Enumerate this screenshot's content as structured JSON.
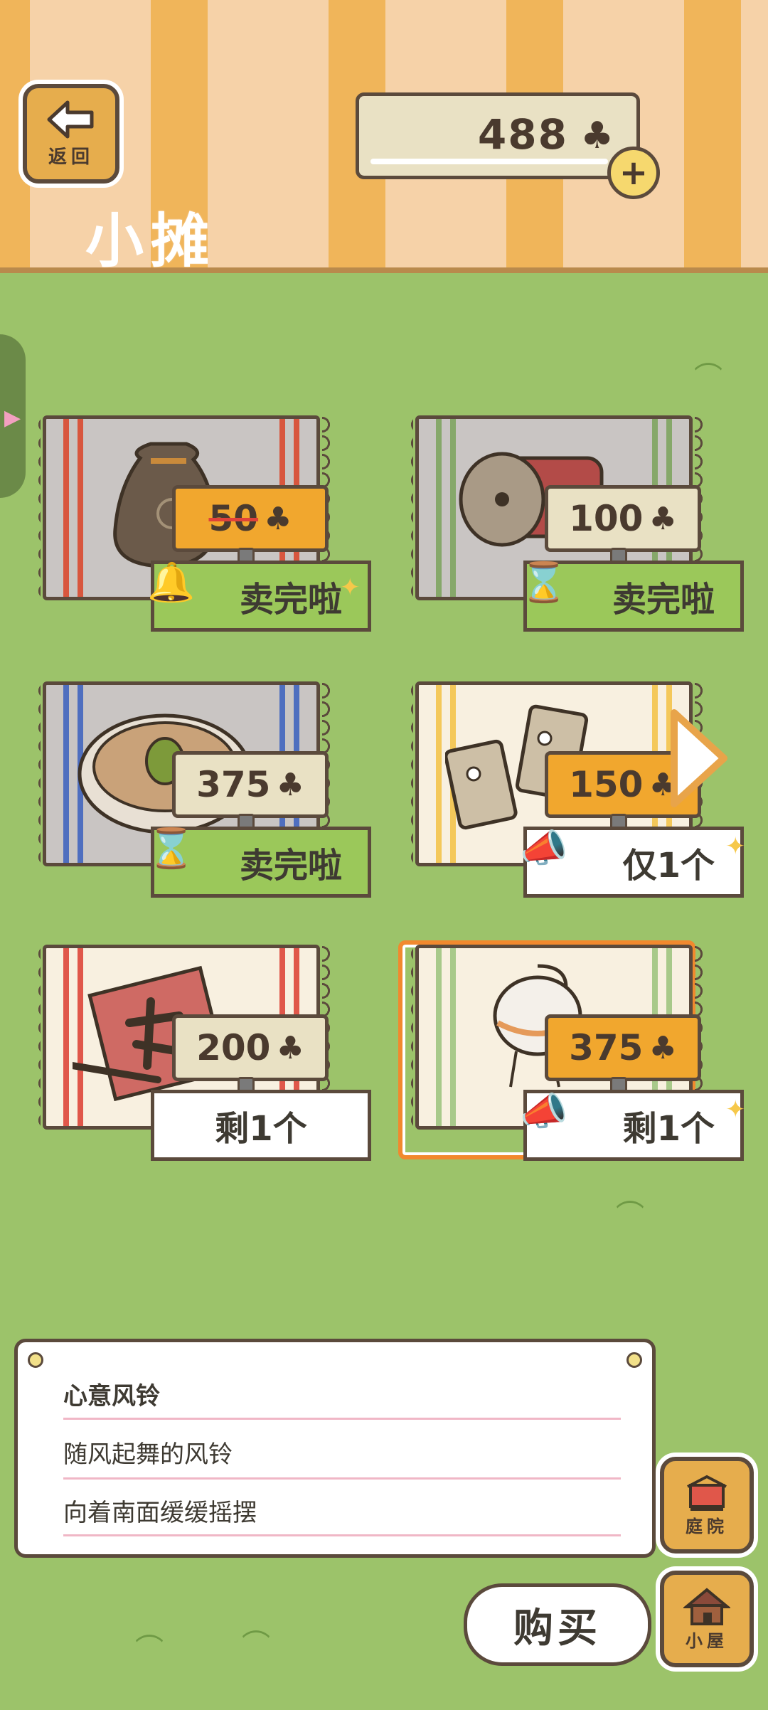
{
  "header": {
    "back_label": "返回",
    "coins": "488",
    "coin_icon": "clover-icon",
    "plus_label": "+",
    "title": "小摊"
  },
  "items": [
    {
      "name": "sack",
      "price": "50",
      "status": "卖完啦",
      "status_icon": "bell-icon",
      "strike": true
    },
    {
      "name": "drum",
      "price": "100",
      "status": "卖完啦",
      "status_icon": "hourglass-icon",
      "strike": false
    },
    {
      "name": "dumplings",
      "price": "375",
      "status": "卖完啦",
      "status_icon": "hourglass-icon",
      "strike": false
    },
    {
      "name": "dominoes",
      "price": "150",
      "status": "仅1个",
      "status_icon": "megaphone-icon",
      "strike": false
    },
    {
      "name": "calligraphy",
      "price": "200",
      "status": "剩1个",
      "status_icon": "",
      "strike": false
    },
    {
      "name": "wind-chime",
      "price": "375",
      "status": "剩1个",
      "status_icon": "megaphone-icon",
      "strike": false
    }
  ],
  "description": {
    "name": "心意风铃",
    "line1": "随风起舞的风铃",
    "line2": "向着南面缓缓摇摆"
  },
  "buttons": {
    "yard": "庭院",
    "house": "小屋",
    "buy": "购买"
  },
  "colors": {
    "grass": "#9cc36a",
    "gold_tag": "#f1a72e",
    "green_tag": "#9bc85a",
    "selection": "#f1892e"
  }
}
